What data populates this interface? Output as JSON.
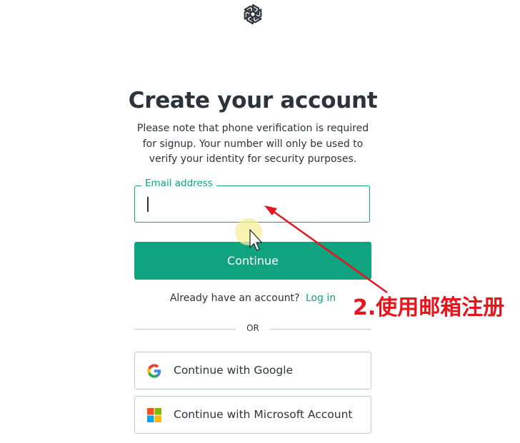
{
  "header": {
    "logo_icon": "openai-logo-icon"
  },
  "main": {
    "title": "Create your account",
    "subtitle": "Please note that phone verification is required for signup. Your number will only be used to verify your identity for security purposes.",
    "email": {
      "label": "Email address",
      "value": ""
    },
    "continue_label": "Continue",
    "already_text": "Already have an account?",
    "login_label": "Log in",
    "divider_text": "OR",
    "social": [
      {
        "label": "Continue with Google",
        "icon": "google-icon"
      },
      {
        "label": "Continue with Microsoft Account",
        "icon": "microsoft-icon"
      }
    ]
  },
  "annotation": {
    "text": "2.使用邮箱注册",
    "color": "#e8141d"
  },
  "colors": {
    "accent": "#10a37f",
    "text": "#2d333a",
    "border": "#c2c8d0"
  }
}
